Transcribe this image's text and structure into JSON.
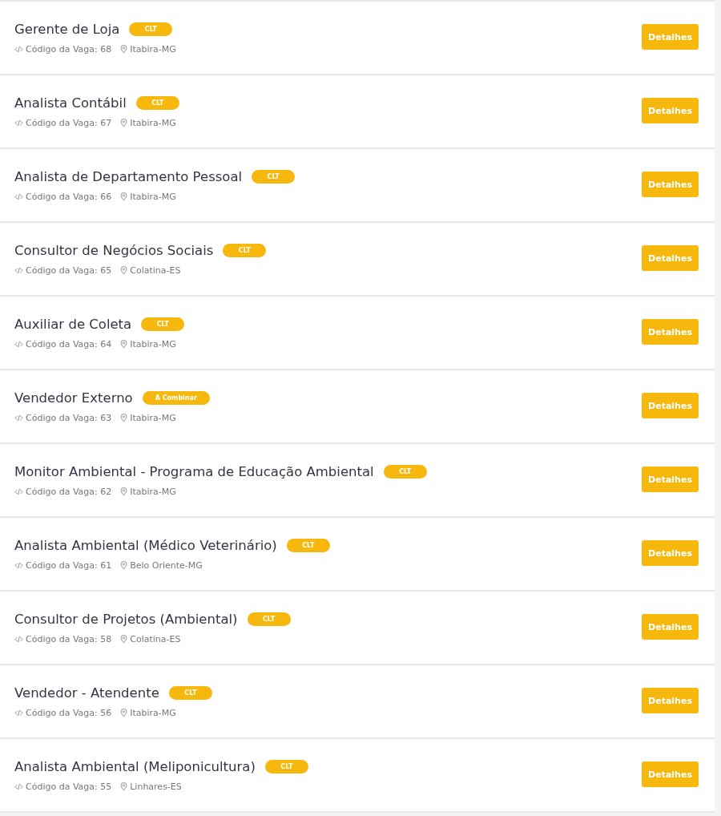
{
  "jobs": [
    {
      "title": "Gerente de Loja",
      "badge": "CLT",
      "code": "Código da Vaga: 68",
      "location": "Itabira-MG",
      "button": "Detalhes"
    },
    {
      "title": "Analista Contábil",
      "badge": "CLT",
      "code": "Código da Vaga: 67",
      "location": "Itabira-MG",
      "button": "Detalhes"
    },
    {
      "title": "Analista de Departamento Pessoal",
      "badge": "CLT",
      "code": "Código da Vaga: 66",
      "location": "Itabira-MG",
      "button": "Detalhes"
    },
    {
      "title": "Consultor de Negócios Sociais",
      "badge": "CLT",
      "code": "Código da Vaga: 65",
      "location": "Colatina-ES",
      "button": "Detalhes"
    },
    {
      "title": "Auxiliar de Coleta",
      "badge": "CLT",
      "code": "Código da Vaga: 64",
      "location": "Itabira-MG",
      "button": "Detalhes"
    },
    {
      "title": "Vendedor Externo",
      "badge": "A Combinar",
      "code": "Código da Vaga: 63",
      "location": "Itabira-MG",
      "button": "Detalhes"
    },
    {
      "title": "Monitor Ambiental - Programa de Educação Ambiental",
      "badge": "CLT",
      "code": "Código da Vaga: 62",
      "location": "Itabira-MG",
      "button": "Detalhes"
    },
    {
      "title": "Analista Ambiental (Médico Veterinário)",
      "badge": "CLT",
      "code": "Código da Vaga: 61",
      "location": "Belo Oriente-MG",
      "button": "Detalhes"
    },
    {
      "title": "Consultor de Projetos (Ambiental)",
      "badge": "CLT",
      "code": "Código da Vaga: 58",
      "location": "Colatina-ES",
      "button": "Detalhes"
    },
    {
      "title": "Vendedor - Atendente",
      "badge": "CLT",
      "code": "Código da Vaga: 56",
      "location": "Itabira-MG",
      "button": "Detalhes"
    },
    {
      "title": "Analista Ambiental (Meliponicultura)",
      "badge": "CLT",
      "code": "Código da Vaga: 55",
      "location": "Linhares-ES",
      "button": "Detalhes"
    }
  ]
}
